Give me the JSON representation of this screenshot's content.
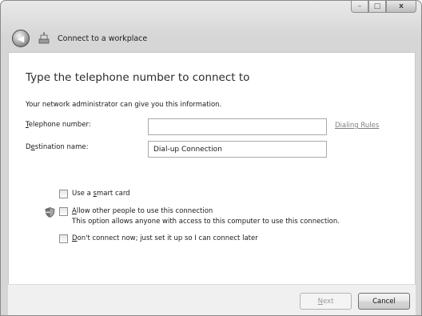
{
  "window": {
    "caption_buttons": {
      "minimize": "–",
      "maximize": "□",
      "close": "x"
    }
  },
  "wizard": {
    "title": "Connect to a workplace",
    "heading": "Type the telephone number to connect to",
    "info": "Your network administrator can give you this information."
  },
  "form": {
    "telephone": {
      "label_accel": "T",
      "label_rest": "elephone number:",
      "value": "",
      "placeholder": ""
    },
    "dialing_rules_link": "Dialing Rules",
    "destination": {
      "label_pre": "D",
      "label_accel": "e",
      "label_rest": "stination name:",
      "value": "Dial-up Connection"
    }
  },
  "options": {
    "smart_card": {
      "pre": "Use a ",
      "accel": "s",
      "rest": "mart card",
      "checked": false
    },
    "allow_others": {
      "accel": "A",
      "rest": "llow other people to use this connection",
      "description": "This option allows anyone with access to this computer to use this connection.",
      "checked": false
    },
    "connect_later": {
      "accel": "D",
      "rest": "on't connect now; just set it up so I can connect later",
      "checked": false
    }
  },
  "buttons": {
    "next_pre": "",
    "next_accel": "N",
    "next_rest": "ext",
    "cancel": "Cancel"
  },
  "icons": {
    "back": "back-arrow-icon",
    "wizard": "workplace-network-icon",
    "uac": "uac-shield-icon"
  }
}
